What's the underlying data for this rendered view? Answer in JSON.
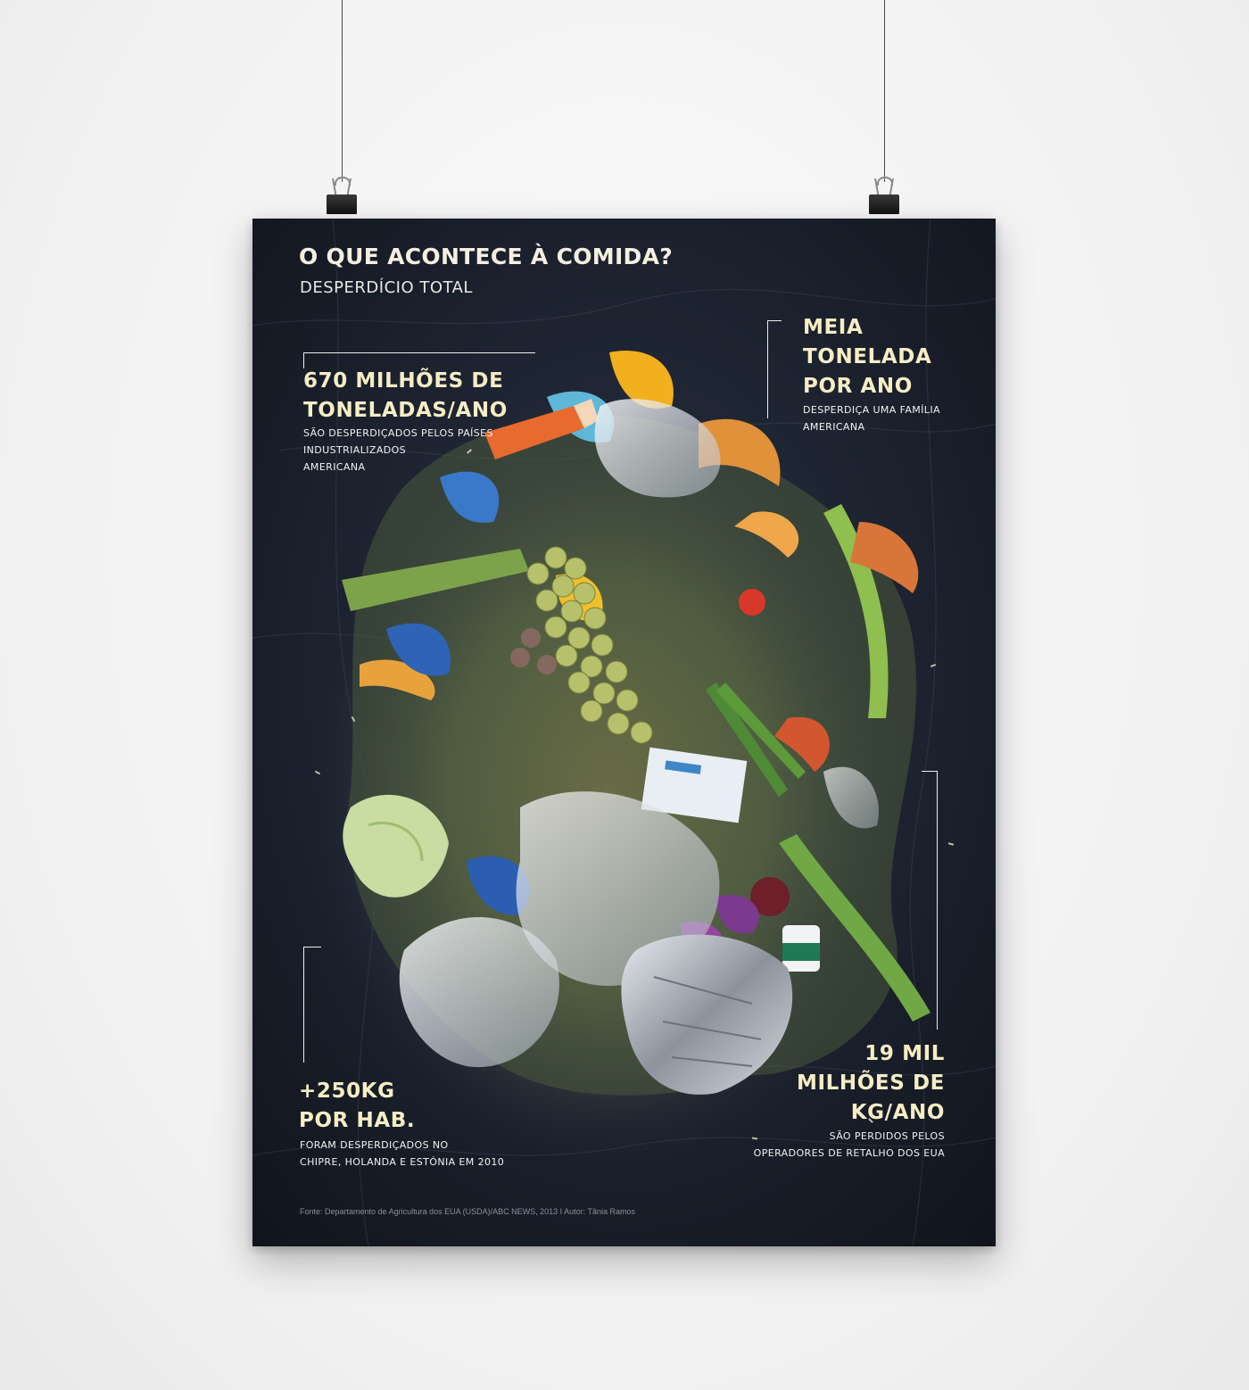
{
  "poster": {
    "title": "O QUE ACONTECE À COMIDA?",
    "subtitle": "DESPERDÍCIO TOTAL",
    "footer": "Fonte: Departamento de Agricultura dos EUA (USDA)/ABC NEWS, 2013   I   Autor: Tânia Ramos",
    "stats": {
      "top_left": {
        "head_1": "670 MILHÕES DE",
        "head_2": "TONELADAS/ANO",
        "sub_1": "SÃO DESPERDIÇADOS PELOS PAÍSES",
        "sub_2": "INDUSTRIALIZADOS",
        "sub_3": "AMERICANA"
      },
      "top_right": {
        "head_1": "MEIA",
        "head_2": "TONELADA",
        "head_3": "POR ANO",
        "sub_1": "DESPERDIÇA UMA FAMÍLIA",
        "sub_2": "AMERICANA"
      },
      "bottom_left": {
        "head_1": "+250KG",
        "head_2": "POR HAB.",
        "sub_1": "FORAM DESPERDIÇADOS NO",
        "sub_2": "CHIPRE, HOLANDA E ESTÓNIA EM 2010"
      },
      "bottom_right": {
        "head_1": "19 MIL",
        "head_2": "MILHÕES DE",
        "head_3": "KG/ANO",
        "sub_1": "SÃO PERDIDOS PELOS",
        "sub_2": "OPERADORES DE RETALHO DOS EUA"
      }
    }
  },
  "colors": {
    "background_plastic": "#1b2230",
    "headline": "#f6edc4",
    "text": "#f2f2f2"
  }
}
